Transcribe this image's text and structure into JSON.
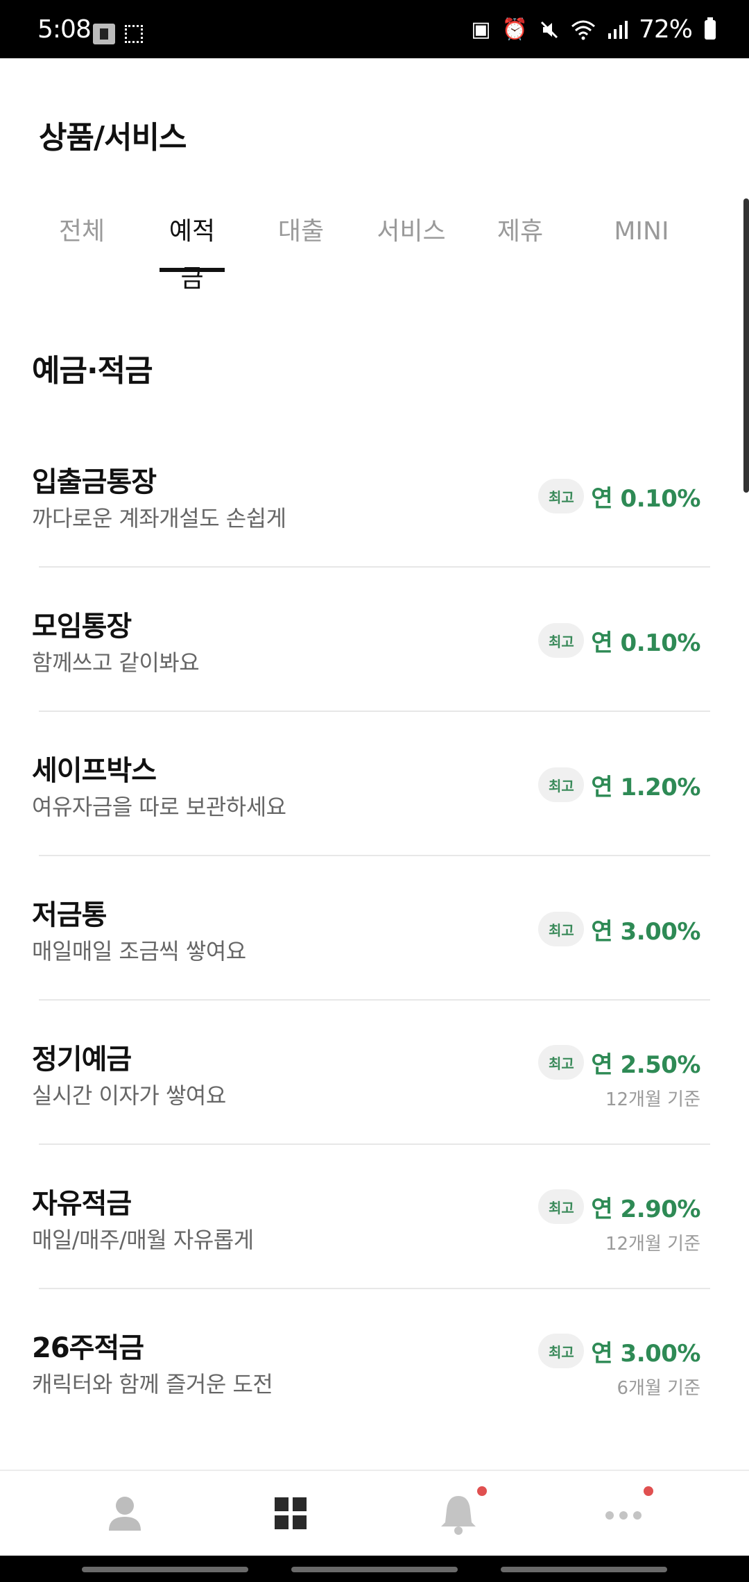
{
  "status_bar": {
    "time": "5:08",
    "battery": "72%",
    "icons": [
      "notification-box-icon",
      "screenshot-icon",
      "battery-saver-icon",
      "alarm-icon",
      "mute-icon",
      "wifi-icon",
      "signal-icon",
      "battery-icon"
    ]
  },
  "header": {
    "title": "상품/서비스"
  },
  "tabs": [
    {
      "label": "전체"
    },
    {
      "label": "예적금"
    },
    {
      "label": "대출"
    },
    {
      "label": "서비스"
    },
    {
      "label": "제휴"
    },
    {
      "label": "MINI"
    }
  ],
  "active_tab": "예적금",
  "section": {
    "title": "예금·적금"
  },
  "products": [
    {
      "name": "입출금통장",
      "desc": "까다로운 계좌개설도 손쉽게",
      "badge": "최고",
      "rate": "연 0.10%",
      "basis": ""
    },
    {
      "name": "모임통장",
      "desc": "함께쓰고 같이봐요",
      "badge": "최고",
      "rate": "연 0.10%",
      "basis": ""
    },
    {
      "name": "세이프박스",
      "desc": "여유자금을 따로 보관하세요",
      "badge": "최고",
      "rate": "연 1.20%",
      "basis": ""
    },
    {
      "name": "저금통",
      "desc": "매일매일 조금씩 쌓여요",
      "badge": "최고",
      "rate": "연 3.00%",
      "basis": ""
    },
    {
      "name": "정기예금",
      "desc": "실시간 이자가 쌓여요",
      "badge": "최고",
      "rate": "연 2.50%",
      "basis": "12개월 기준"
    },
    {
      "name": "자유적금",
      "desc": "매일/매주/매월 자유롭게",
      "badge": "최고",
      "rate": "연 2.90%",
      "basis": "12개월 기준"
    },
    {
      "name": "26주적금",
      "desc": "캐릭터와 함께 즐거운 도전",
      "badge": "최고",
      "rate": "연 3.00%",
      "basis": "6개월 기준"
    }
  ],
  "bottom_nav": {
    "items": [
      "profile-icon",
      "products-grid-icon",
      "notifications-bell-icon",
      "more-dots-icon"
    ],
    "accent": "#e05050"
  },
  "colors": {
    "rate": "#2e8a55",
    "badge_bg": "#f0f0f0"
  }
}
